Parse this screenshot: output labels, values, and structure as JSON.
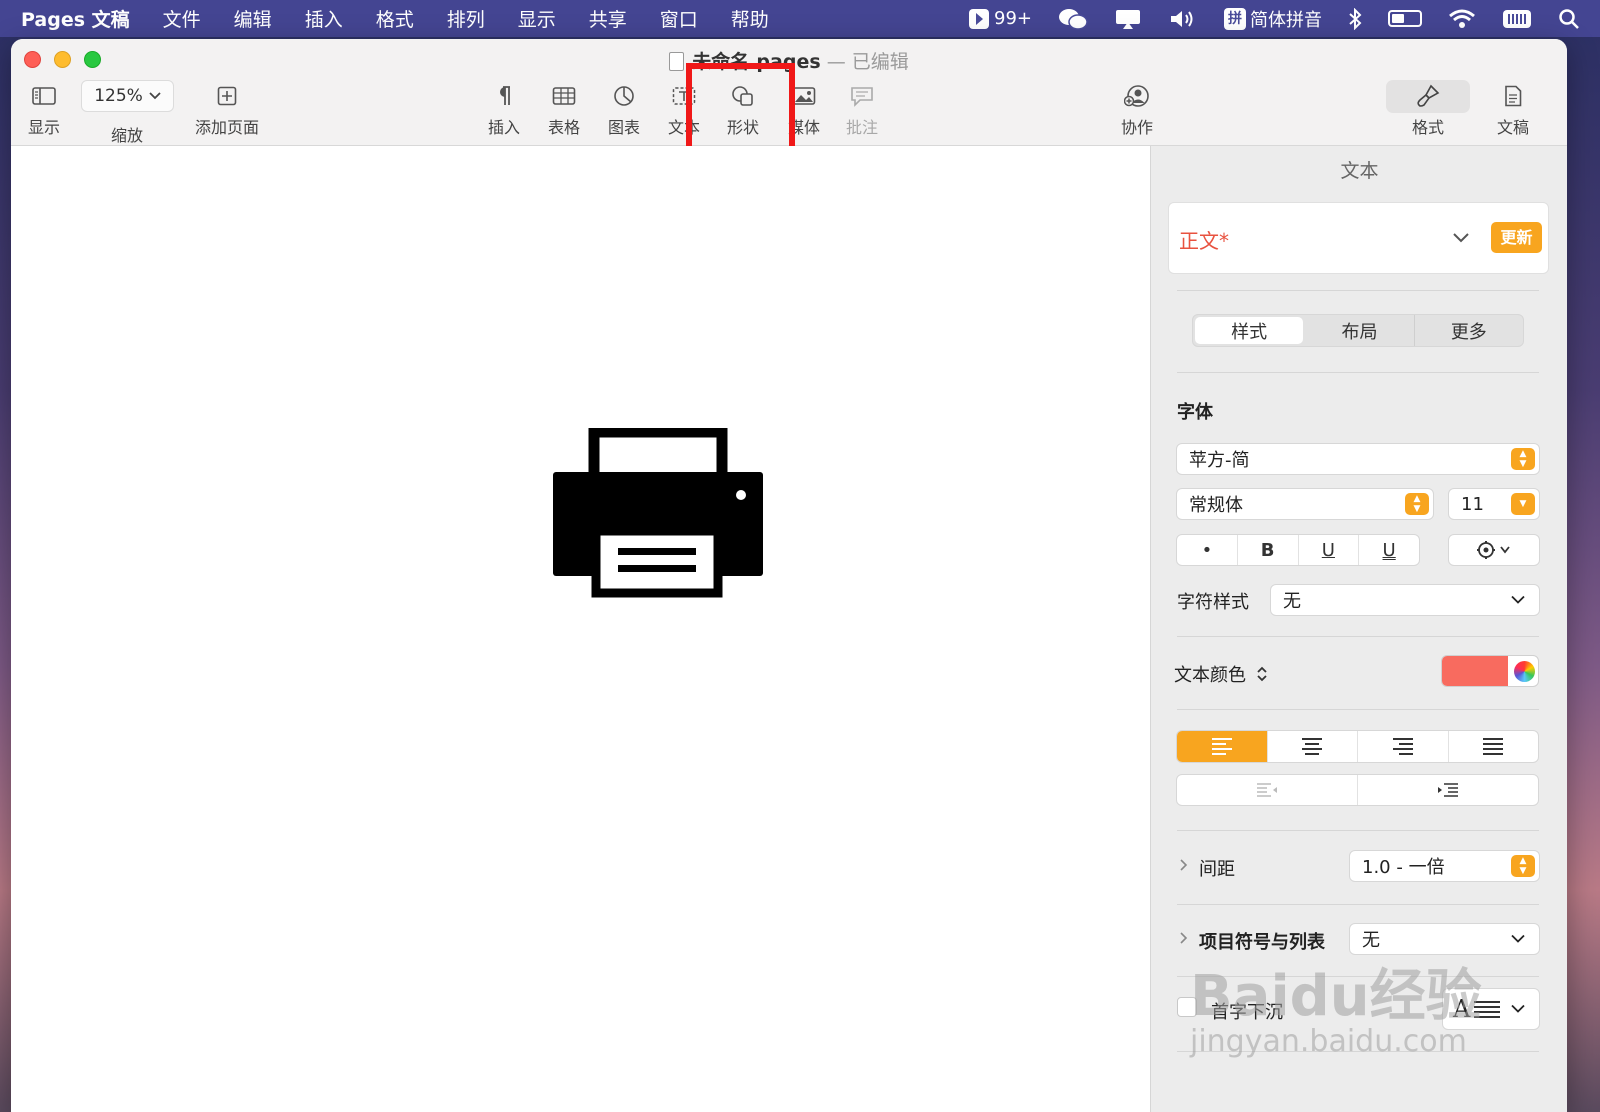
{
  "menubar": {
    "app_name": "Pages 文稿",
    "items": [
      "文件",
      "编辑",
      "插入",
      "格式",
      "排列",
      "显示",
      "共享",
      "窗口",
      "帮助"
    ],
    "status_badge": "99+",
    "input_method": "简体拼音",
    "input_method_glyph": "拼"
  },
  "window": {
    "title": "未命名.pages",
    "title_sep": "—",
    "edited_label": "已编辑"
  },
  "toolbar": {
    "view_label": "显示",
    "zoom_value": "125%",
    "zoom_label": "缩放",
    "add_page_label": "添加页面",
    "insert_label": "插入",
    "table_label": "表格",
    "chart_label": "图表",
    "text_label": "文本",
    "shape_label": "形状",
    "media_label": "媒体",
    "comment_label": "批注",
    "collaborate_label": "协作",
    "format_label": "格式",
    "document_label": "文稿",
    "highlight_color": "#f01818"
  },
  "inspector": {
    "title": "文本",
    "paragraph_style": "正文*",
    "paragraph_style_color": "#e8523f",
    "update_label": "更新",
    "tabs": [
      "样式",
      "布局",
      "更多"
    ],
    "font_section": "字体",
    "font_family": "苹方-简",
    "font_weight": "常规体",
    "font_size": "11",
    "bold_label": "B",
    "italic_label": "•",
    "underline_label": "U",
    "strike_label": "U",
    "char_style_label": "字符样式",
    "char_style_value": "无",
    "text_color_label": "文本颜色",
    "text_color": "#f86b5f",
    "accent_color": "#f8a51f",
    "spacing_label": "间距",
    "spacing_value": "1.0 - 一倍",
    "bullets_label": "项目符号与列表",
    "bullets_value": "无",
    "dropcap_label": "首字下沉",
    "dropcap_glyph": "A"
  },
  "watermark": {
    "brand": "Baidu经验",
    "url": "jingyan.baidu.com"
  }
}
